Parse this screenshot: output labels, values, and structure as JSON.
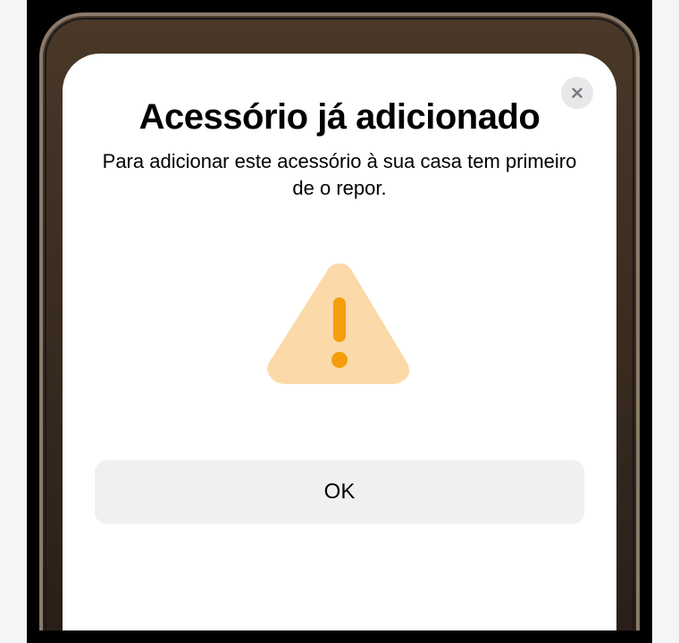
{
  "modal": {
    "title": "Acessório já adicionado",
    "description": "Para adicionar este acessório à sua casa tem primeiro de o repor.",
    "ok_label": "OK"
  }
}
